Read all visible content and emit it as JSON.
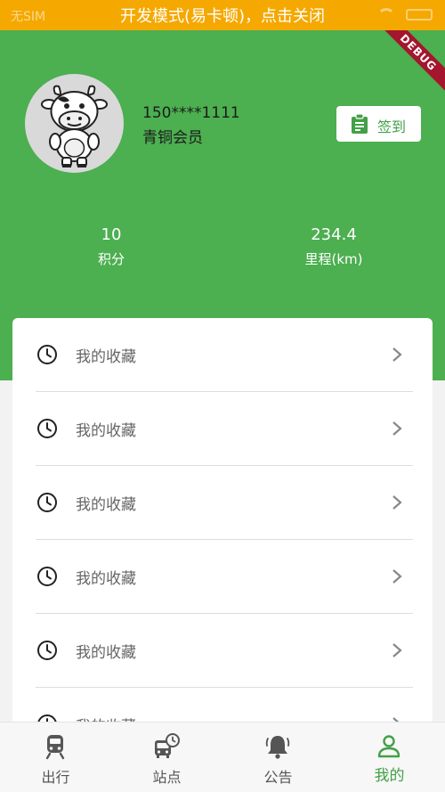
{
  "status_bar": {
    "carrier": "无SIM",
    "dev_banner": "开发模式(易卡顿)，点击关闭"
  },
  "debug_ribbon": "DEBUG",
  "profile": {
    "phone": "150****1111",
    "level": "青铜会员",
    "checkin_label": "签到"
  },
  "stats": [
    {
      "value": "10",
      "label": "积分"
    },
    {
      "value": "234.4",
      "label": "里程(km)"
    }
  ],
  "menu": {
    "items": [
      {
        "label": "我的收藏",
        "icon": "clock-icon"
      },
      {
        "label": "我的收藏",
        "icon": "clock-icon"
      },
      {
        "label": "我的收藏",
        "icon": "clock-icon"
      },
      {
        "label": "我的收藏",
        "icon": "clock-icon"
      },
      {
        "label": "我的收藏",
        "icon": "clock-icon"
      },
      {
        "label": "我的收藏",
        "icon": "clock-icon"
      }
    ]
  },
  "tabs": [
    {
      "label": "出行",
      "icon": "train-icon"
    },
    {
      "label": "站点",
      "icon": "bus-clock-icon"
    },
    {
      "label": "公告",
      "icon": "bell-icon"
    },
    {
      "label": "我的",
      "icon": "user-icon",
      "active": true
    }
  ],
  "colors": {
    "primary": "#4caf50",
    "status_bar": "#f5a800",
    "accent_text": "#43a047",
    "debug_ribbon": "#a3162d"
  }
}
